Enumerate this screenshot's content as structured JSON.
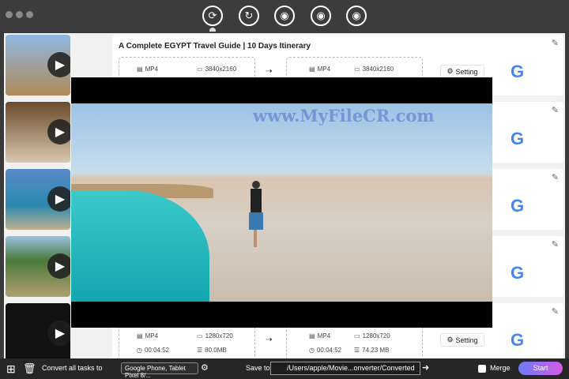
{
  "toolbar": {
    "icons": [
      "convert-icon",
      "rotate-convert-icon",
      "video-download-icon",
      "video-edit-icon",
      "video-effects-icon"
    ]
  },
  "tasks": [
    {
      "title": "A Complete EGYPT Travel Guide | 10 Days Itinerary",
      "src": {
        "format": "MP4",
        "resolution": "3840x2160"
      },
      "out": {
        "format": "MP4",
        "resolution": "3840x2160"
      }
    },
    {
      "title": "",
      "src": {},
      "out": {}
    },
    {
      "title": "",
      "src": {},
      "out": {}
    },
    {
      "title": "",
      "src": {},
      "out": {}
    },
    {
      "title": "",
      "src": {
        "format": "MP4",
        "resolution": "1280x720",
        "duration": "00:04:52",
        "size": "80.0MB"
      },
      "out": {
        "format": "MP4",
        "resolution": "1280x720",
        "duration": "00:04:52",
        "size": "74.23 MB"
      }
    }
  ],
  "setting_label": "Setting",
  "watermark": "www.MyFileCR.com",
  "bottom": {
    "convert_label": "Convert all tasks to",
    "preset": "Google Phone, Tablet Pixel 8/...",
    "save_label": "Save to",
    "path": "/Users/apple/Movie...onverter/Converted",
    "merge_label": "Merge",
    "start_label": "Start"
  }
}
